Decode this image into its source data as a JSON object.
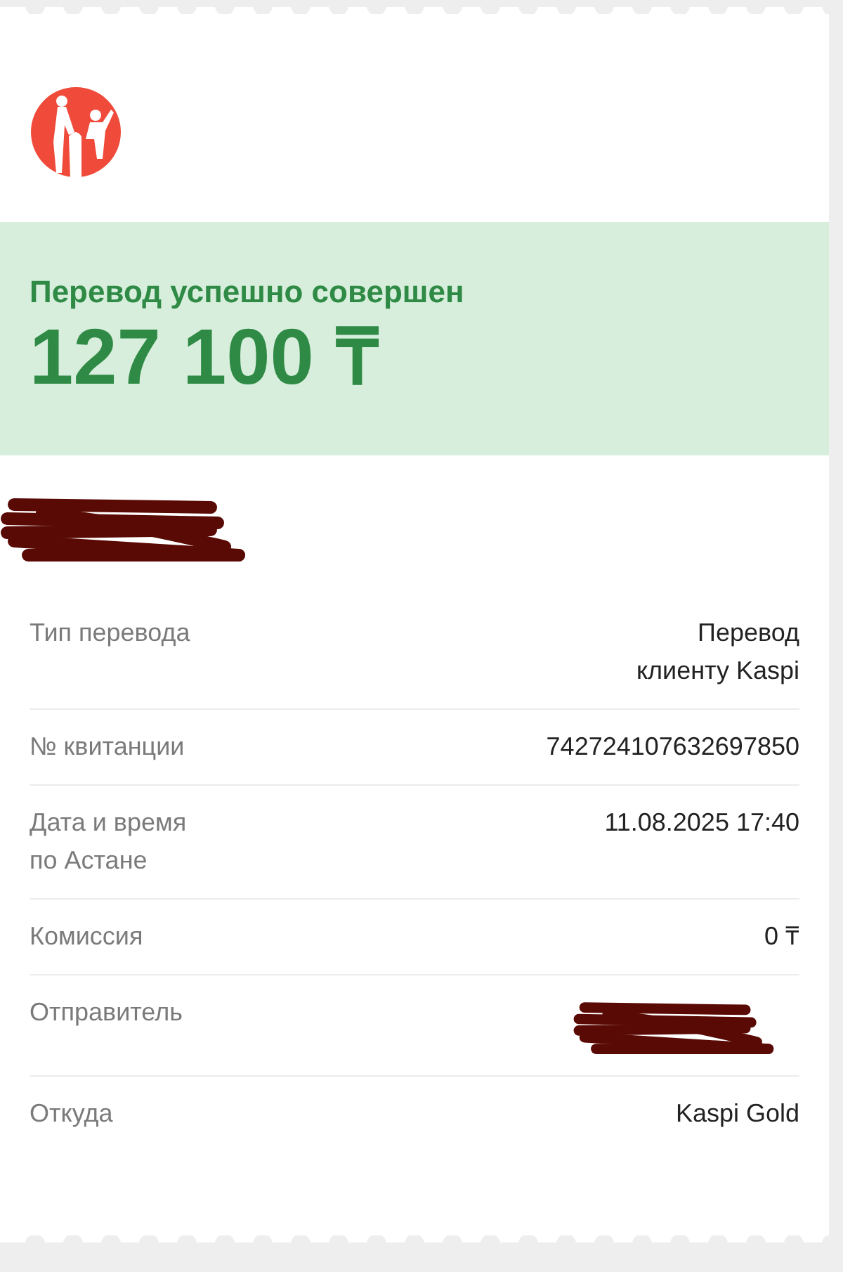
{
  "status": {
    "title": "Перевод успешно совершен",
    "amount": "127 100 ₸"
  },
  "recipient": {
    "kind": "redacted"
  },
  "details": [
    {
      "label": "Тип перевода",
      "kind": "text",
      "value": "Перевод\nклиенту Kaspi"
    },
    {
      "label": "№ квитанции",
      "kind": "text",
      "value": "742724107632697850"
    },
    {
      "label": "Дата и время\nпо Астане",
      "kind": "text",
      "value": "11.08.2025 17:40"
    },
    {
      "label": "Комиссия",
      "kind": "text",
      "value": "0 ₸"
    },
    {
      "label": "Отправитель",
      "kind": "redacted"
    },
    {
      "label": "Откуда",
      "kind": "text",
      "value": "Kaspi Gold"
    }
  ]
}
